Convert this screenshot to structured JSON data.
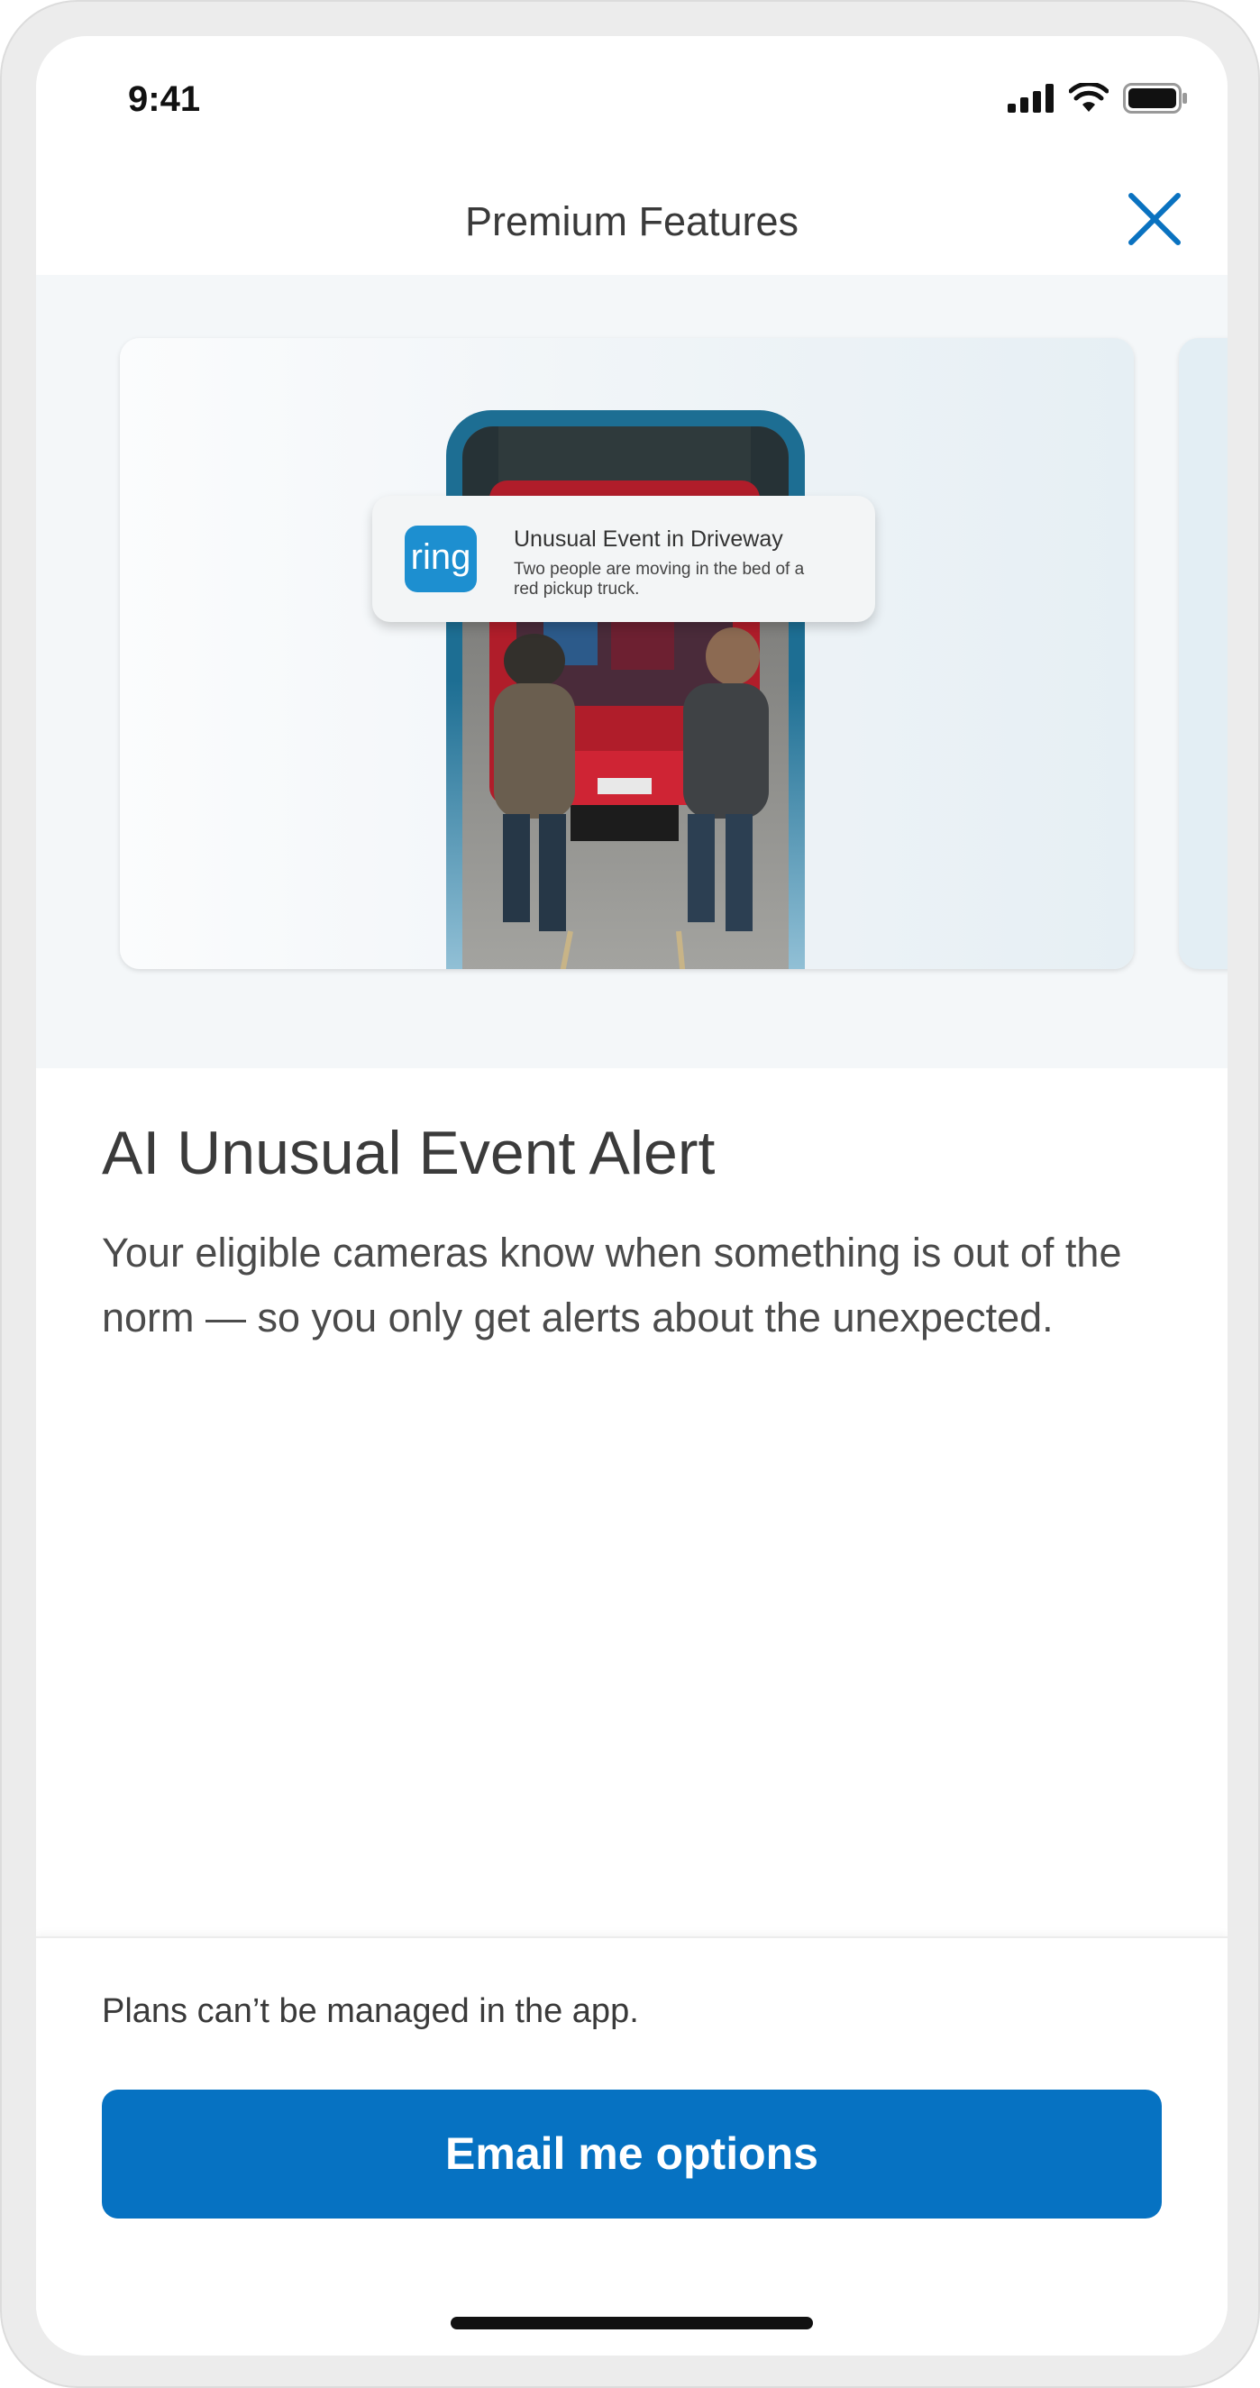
{
  "status_bar": {
    "time": "9:41"
  },
  "nav": {
    "title": "Premium Features"
  },
  "carousel": {
    "notification": {
      "logo_text": "ring",
      "title": "Unusual Event in Driveway",
      "body": "Two people are moving in the bed of a red pickup truck."
    }
  },
  "feature": {
    "title": "AI Unusual Event Alert",
    "description": "Your eligible cameras know when something is out of the norm — so you only get alerts about the unexpected."
  },
  "footer": {
    "note": "Plans can’t be managed in the app.",
    "cta_label": "Email me options"
  },
  "colors": {
    "accent": "#0672c2",
    "ring_blue": "#1d8fd0",
    "close_icon": "#0a72c0"
  }
}
